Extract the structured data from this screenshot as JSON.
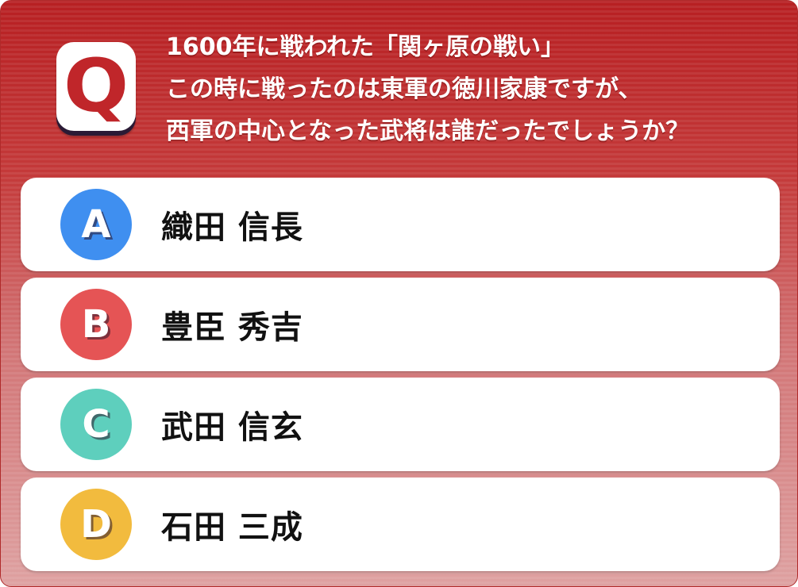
{
  "question": {
    "badge_letter": "Q",
    "lines": [
      "1600年に戦われた「関ヶ原の戦い」",
      "この時に戦ったのは東軍の徳川家康ですが、",
      "西軍の中心となった武将は誰だったでしょうか？"
    ]
  },
  "colors": {
    "header_red": "#b71f22",
    "option_a": "#3f8ff0",
    "option_b": "#e55455",
    "option_c": "#5ecfbd",
    "option_d": "#f2bb3e"
  },
  "answers": [
    {
      "letter": "A",
      "text": "織田 信長"
    },
    {
      "letter": "B",
      "text": "豊臣 秀吉"
    },
    {
      "letter": "C",
      "text": "武田 信玄"
    },
    {
      "letter": "D",
      "text": "石田 三成"
    }
  ]
}
